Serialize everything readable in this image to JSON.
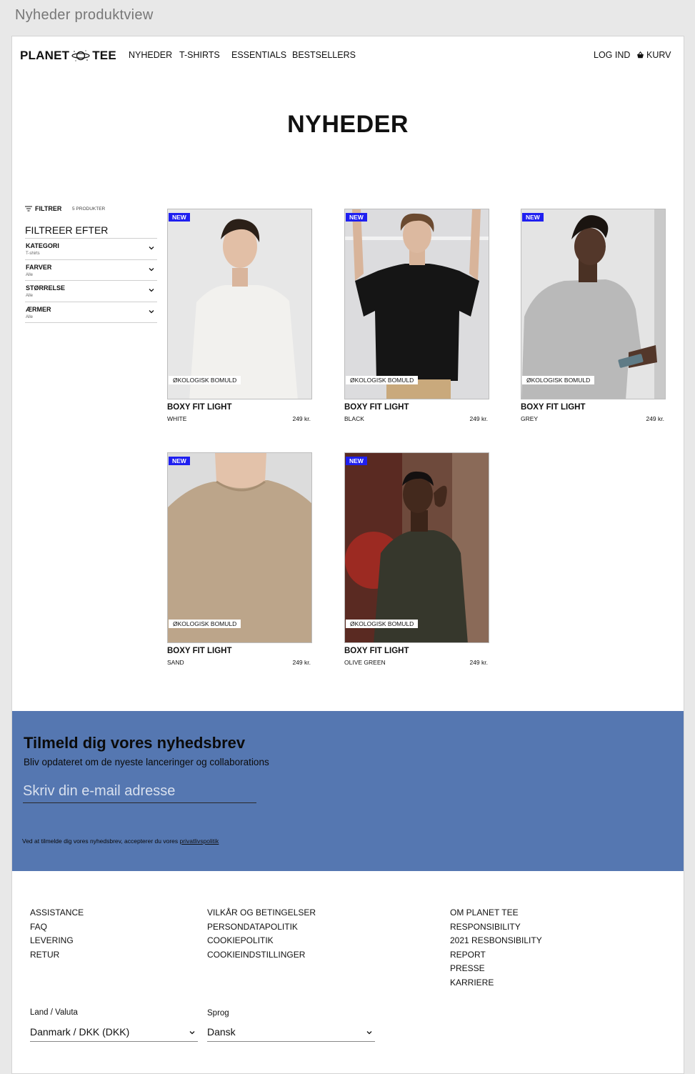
{
  "frame": {
    "title": "Nyheder produktview"
  },
  "header": {
    "logo_left": "PLANET",
    "logo_right": "TEE",
    "nav": [
      "NYHEDER",
      "T-SHIRTS",
      "ESSENTIALS",
      "BESTSELLERS"
    ],
    "login": "LOG IND",
    "cart": "KURV"
  },
  "page": {
    "title": "NYHEDER"
  },
  "filters": {
    "toggle_label": "FILTRER",
    "count": "5 PRODUKTER",
    "heading": "FILTREER EFTER",
    "items": [
      {
        "name": "KATEGORI",
        "value": "T-shirts"
      },
      {
        "name": "FARVER",
        "value": "Alle"
      },
      {
        "name": "STØRRELSE",
        "value": "Alle"
      },
      {
        "name": "ÆRMER",
        "value": "Alle"
      }
    ]
  },
  "products": [
    {
      "badge": "NEW",
      "tag": "ØKOLOGISK BOMULD",
      "name": "BOXY FIT LIGHT",
      "color": "WHITE",
      "price": "249 kr.",
      "swatch": "#f2f1ee"
    },
    {
      "badge": "NEW",
      "tag": "ØKOLOGISK BOMULD",
      "name": "BOXY FIT LIGHT",
      "color": "BLACK",
      "price": "249 kr.",
      "swatch": "#151515"
    },
    {
      "badge": "NEW",
      "tag": "ØKOLOGISK BOMULD",
      "name": "BOXY FIT LIGHT",
      "color": "GREY",
      "price": "249 kr.",
      "swatch": "#b9b9b9"
    },
    {
      "badge": "NEW",
      "tag": "ØKOLOGISK BOMULD",
      "name": "BOXY FIT LIGHT",
      "color": "SAND",
      "price": "249 kr.",
      "swatch": "#bca58a"
    },
    {
      "badge": "NEW",
      "tag": "ØKOLOGISK BOMULD",
      "name": "BOXY FIT LIGHT",
      "color": "OLIVE GREEN",
      "price": "249 kr.",
      "swatch": "#36372c"
    }
  ],
  "newsletter": {
    "title": "Tilmeld dig vores nyhedsbrev",
    "subtitle": "Bliv opdateret om de nyeste lanceringer og collaborations",
    "placeholder": "Skriv din e-mail adresse",
    "note": "Ved at tilmelde dig vores nyhedsbrev, accepterer du vores",
    "note_link": "privatlivspolitik",
    "background": "#5577b1"
  },
  "footer": {
    "col1": [
      "ASSISTANCE",
      "FAQ",
      "LEVERING",
      "RETUR"
    ],
    "col2": [
      "VILKÅR OG BETINGELSER",
      "PERSONDATAPOLITIK",
      "COOKIEPOLITIK",
      "COOKIEINDSTILLINGER"
    ],
    "col3": [
      "OM PLANET TEE",
      "RESPONSIBILITY",
      "2021 RESBONSIBILITY",
      "REPORT",
      "PRESSE",
      "KARRIERE"
    ],
    "country_label": "Land / Valuta",
    "country_value": "Danmark / DKK (DKK)",
    "language_label": "Sprog",
    "language_value": "Dansk"
  }
}
